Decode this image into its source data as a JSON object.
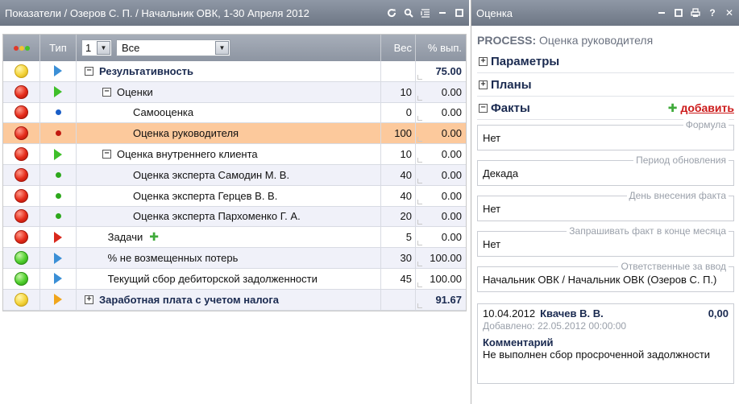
{
  "left_window": {
    "title": "Показатели / Озеров С. П. / Начальник ОВК, 1-30 Апреля 2012",
    "icons": [
      "refresh-icon",
      "search-icon",
      "list-icon",
      "minimize-icon",
      "maximize-icon"
    ]
  },
  "grid": {
    "headers": {
      "type": "Тип",
      "weight": "Вес",
      "percent": "% вып."
    },
    "filter_level": "1",
    "filter_all": "Все",
    "rows": [
      {
        "status": "yellow",
        "type": "blue-tri",
        "indent": 0,
        "expander": "⊟",
        "name": "Результативность",
        "bold": true,
        "weight": "",
        "percent": "75.00",
        "style": "plain"
      },
      {
        "status": "red",
        "type": "green-tri",
        "indent": 1,
        "expander": "⊟",
        "name": "Оценки",
        "bold": false,
        "weight": "10",
        "percent": "0.00",
        "style": "alt"
      },
      {
        "status": "red",
        "type": "blue-dot",
        "indent": 2,
        "expander": "",
        "name": "Самооценка",
        "bold": false,
        "weight": "0",
        "percent": "0.00",
        "style": "plain"
      },
      {
        "status": "red",
        "type": "red-dot",
        "indent": 2,
        "expander": "",
        "name": "Оценка руководителя",
        "bold": false,
        "weight": "100",
        "percent": "0.00",
        "style": "sel"
      },
      {
        "status": "red",
        "type": "green-tri",
        "indent": 1,
        "expander": "⊟",
        "name": "Оценка внутреннего клиента",
        "bold": false,
        "weight": "10",
        "percent": "0.00",
        "style": "plain"
      },
      {
        "status": "red",
        "type": "green-dot",
        "indent": 2,
        "expander": "",
        "name": "Оценка эксперта Самодин М. В.",
        "bold": false,
        "weight": "40",
        "percent": "0.00",
        "style": "alt"
      },
      {
        "status": "red",
        "type": "green-dot",
        "indent": 2,
        "expander": "",
        "name": "Оценка эксперта Герцев В. В.",
        "bold": false,
        "weight": "40",
        "percent": "0.00",
        "style": "plain"
      },
      {
        "status": "red",
        "type": "green-dot",
        "indent": 2,
        "expander": "",
        "name": "Оценка эксперта Пархоменко Г. А.",
        "bold": false,
        "weight": "20",
        "percent": "0.00",
        "style": "alt"
      },
      {
        "status": "red",
        "type": "red-tri",
        "indent": 1.3,
        "expander": "",
        "name": "Задачи",
        "bold": false,
        "weight": "5",
        "percent": "0.00",
        "style": "plain",
        "plus": "✚"
      },
      {
        "status": "green",
        "type": "blue-tri",
        "indent": 1.3,
        "expander": "",
        "name": "% не возмещенных потерь",
        "bold": false,
        "weight": "30",
        "percent": "100.00",
        "style": "alt"
      },
      {
        "status": "green",
        "type": "blue-tri",
        "indent": 1.3,
        "expander": "",
        "name": "Текущий сбор дебиторской задолженности",
        "bold": false,
        "weight": "45",
        "percent": "100.00",
        "style": "plain"
      },
      {
        "status": "yellow",
        "type": "orange-tri",
        "indent": 0,
        "expander": "⊞",
        "name": "Заработная плата с учетом налога",
        "bold": true,
        "weight": "",
        "percent": "91.67",
        "style": "alt"
      }
    ]
  },
  "right_window": {
    "title": "Оценка",
    "process_label": "PROCESS:",
    "process_title": "Оценка руководителя",
    "sections": {
      "params": "Параметры",
      "plans": "Планы",
      "facts": "Факты"
    },
    "add_link": "добавить",
    "fields": [
      {
        "legend": "Формула",
        "value": "Нет"
      },
      {
        "legend": "Период обновления",
        "value": "Декада"
      },
      {
        "legend": "День внесения факта",
        "value": "Нет"
      },
      {
        "legend": "Запрашивать факт в конце месяца",
        "value": "Нет"
      },
      {
        "legend": "Ответственные за ввод",
        "value": "Начальник ОВК / Начальник ОВК (Озеров С. П.)"
      }
    ],
    "fact_card": {
      "date": "10.04.2012",
      "name": "Квачев В. В.",
      "amount": "0,00",
      "added": "Добавлено: 22.05.2012 00:00:00",
      "comment_label": "Комментарий",
      "comment_text": "Не выполнен сбор просроченной задолжности"
    }
  }
}
